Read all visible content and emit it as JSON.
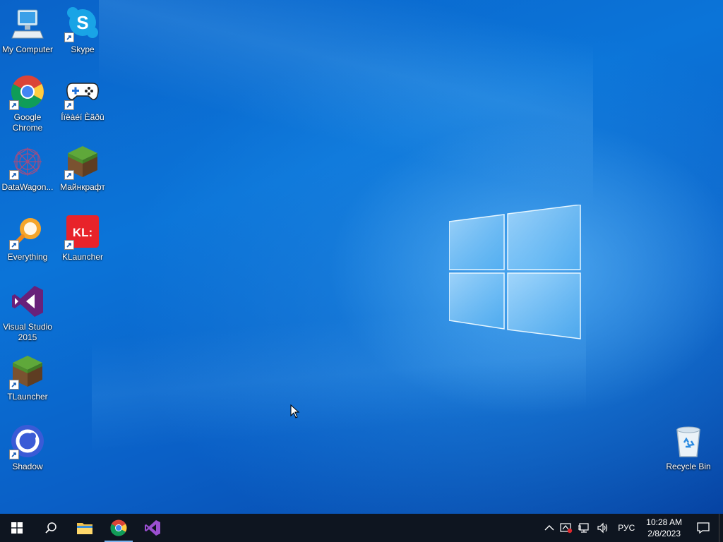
{
  "desktop": {
    "icons": [
      {
        "label": "My Computer"
      },
      {
        "label": "Skype"
      },
      {
        "label": "Google Chrome"
      },
      {
        "label": "Íïëàéí Èãðû"
      },
      {
        "label": "DataWagon..."
      },
      {
        "label": "Майнкрафт"
      },
      {
        "label": "Everything"
      },
      {
        "label": "KLauncher"
      },
      {
        "label": "Visual Studio 2015"
      },
      {
        "label": "TLauncher"
      },
      {
        "label": "Shadow"
      },
      {
        "label": "Recycle Bin"
      }
    ],
    "klauncher_logo_text": "KL:",
    "skype_logo_text": "S"
  },
  "taskbar": {
    "pinned": [
      "start-icon",
      "search-icon",
      "file-explorer-icon",
      "chrome-icon",
      "visual-studio-icon"
    ],
    "tray": {
      "language": "РУС",
      "time": "10:28 AM",
      "date": "2/8/2023"
    }
  },
  "colors": {
    "accent": "#0078d7",
    "taskbar": "#0e1520"
  }
}
